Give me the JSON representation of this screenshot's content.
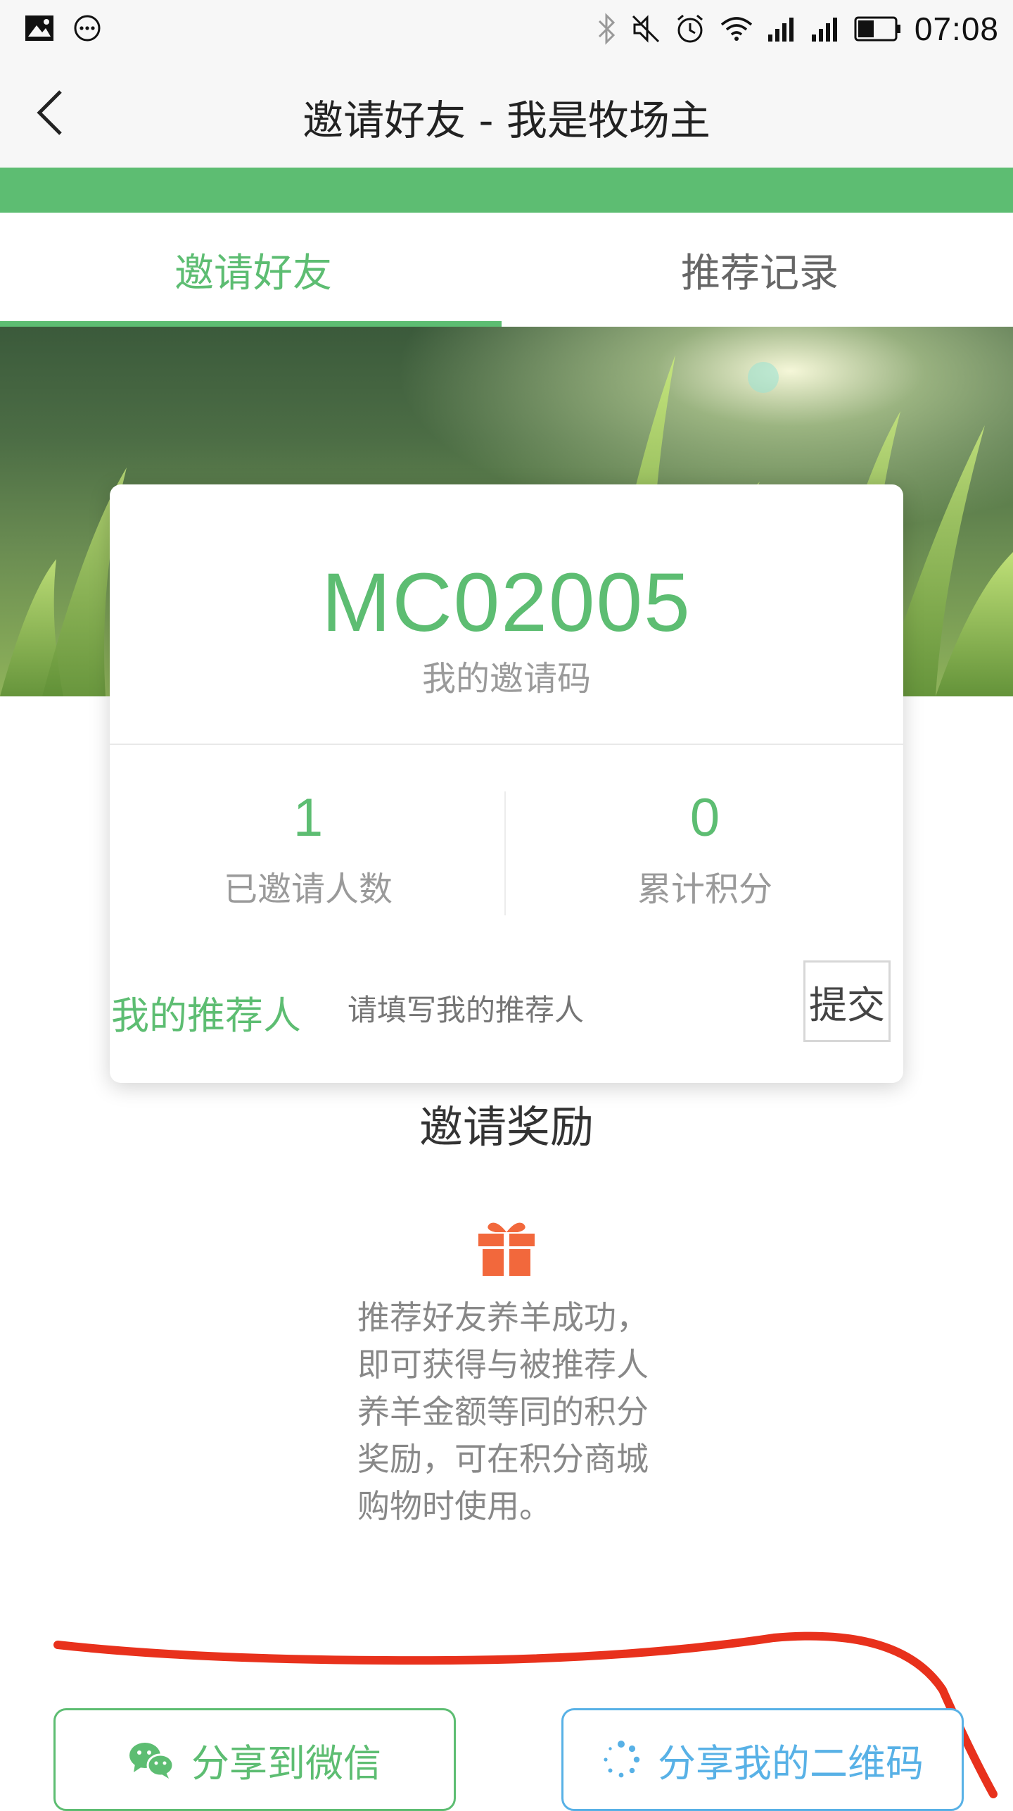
{
  "status_bar": {
    "time": "07:08",
    "icons": [
      "image-icon",
      "more-icon",
      "bluetooth-icon",
      "mute-icon",
      "alarm-icon",
      "wifi-icon",
      "signal-icon",
      "signal-icon",
      "battery-icon"
    ]
  },
  "header": {
    "title": "邀请好友 - 我是牧场主",
    "back_icon": "chevron-left-icon"
  },
  "tabs": [
    {
      "label": "邀请好友",
      "active": true
    },
    {
      "label": "推荐记录",
      "active": false
    }
  ],
  "card": {
    "code": "MC02005",
    "code_label": "我的邀请码",
    "stats": [
      {
        "value": "1",
        "label": "已邀请人数"
      },
      {
        "value": "0",
        "label": "累计积分"
      }
    ],
    "referrer_label": "我的推荐人",
    "referrer_placeholder": "请填写我的推荐人",
    "submit_label": "提交"
  },
  "reward": {
    "title": "邀请奖励",
    "icon": "gift-icon",
    "text": "推荐好友养羊成功，即可获得与被推荐人养羊金额等同的积分奖励，可在积分商城购物时使用。"
  },
  "actions": {
    "share_wechat": "分享到微信",
    "share_qr": "分享我的二维码"
  },
  "colors": {
    "accent_green": "#5dbd72",
    "accent_blue": "#58b1e6",
    "gift_orange": "#f2683c",
    "annotation_red": "#e8311c"
  }
}
